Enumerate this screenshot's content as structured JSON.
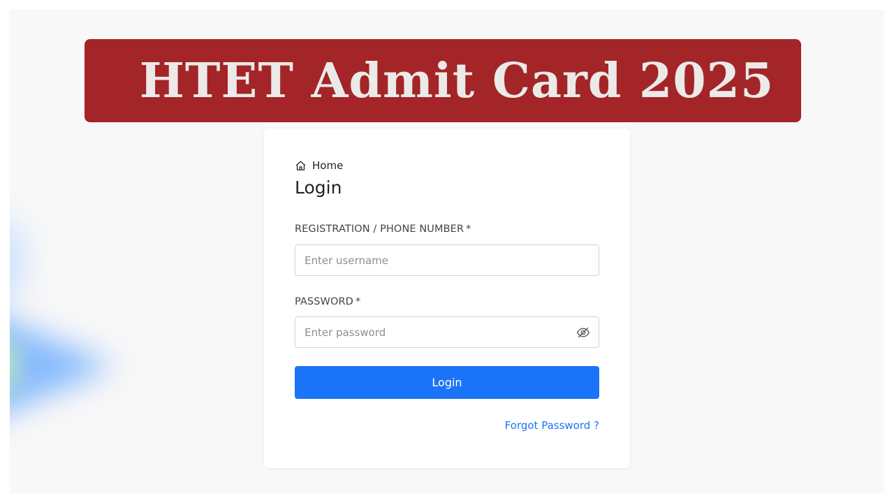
{
  "banner": {
    "title": "HTET Admit Card 2025",
    "background": "#a32527",
    "text_color": "#ece9e9"
  },
  "breadcrumb": {
    "icon": "home-icon",
    "label": "Home"
  },
  "login_form": {
    "title": "Login",
    "username": {
      "label": "REGISTRATION / PHONE NUMBER",
      "required_mark": "*",
      "placeholder": "Enter username",
      "value": ""
    },
    "password": {
      "label": "PASSWORD",
      "required_mark": "*",
      "placeholder": "Enter password",
      "value": "",
      "toggle_icon": "eye-slash-icon"
    },
    "submit_label": "Login",
    "forgot_label": "Forgot Password ?"
  },
  "colors": {
    "accent": "#1b74f8",
    "page_background": "#f8f8f8"
  }
}
